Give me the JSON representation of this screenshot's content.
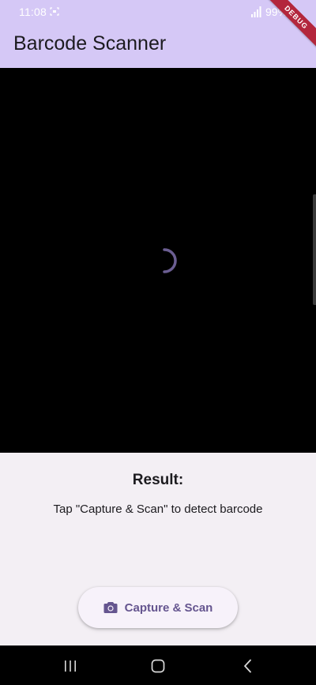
{
  "status_bar": {
    "time": "11:08",
    "battery": "99%",
    "icons": [
      "screenshot-icon",
      "signal-icon",
      "battery-icon"
    ]
  },
  "debug_banner": "DEBUG",
  "app_bar": {
    "title": "Barcode Scanner"
  },
  "camera": {
    "state": "loading"
  },
  "result": {
    "heading": "Result:",
    "message": "Tap \"Capture & Scan\" to detect barcode"
  },
  "actions": {
    "capture_label": "Capture & Scan",
    "capture_icon": "camera-icon"
  },
  "navigation": {
    "items": [
      "recents-icon",
      "home-icon",
      "back-icon"
    ]
  },
  "colors": {
    "app_bar": "#d5c8f6",
    "accent": "#65558f",
    "surface": "#f3eff4",
    "debug_ribbon": "#b3263c"
  }
}
